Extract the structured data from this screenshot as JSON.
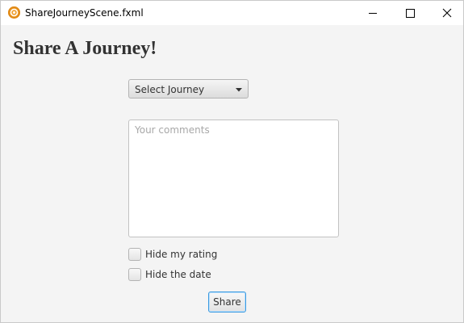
{
  "window": {
    "title": "ShareJourneyScene.fxml",
    "icon": "app-icon",
    "controls": [
      "minimize-icon",
      "maximize-icon",
      "close-icon"
    ]
  },
  "heading": "Share A Journey!",
  "journey_select": {
    "selected": "Select Journey",
    "icon": "chevron-down-icon"
  },
  "comments": {
    "placeholder": "Your comments",
    "value": ""
  },
  "options": {
    "hide_rating": {
      "label": "Hide my rating",
      "checked": false
    },
    "hide_date": {
      "label": "Hide the date",
      "checked": false
    }
  },
  "share_button": {
    "label": "Share"
  },
  "colors": {
    "background": "#f4f4f4",
    "titlebar": "#ffffff",
    "focus_border": "#3b9ae0",
    "heading_text": "#333333"
  }
}
